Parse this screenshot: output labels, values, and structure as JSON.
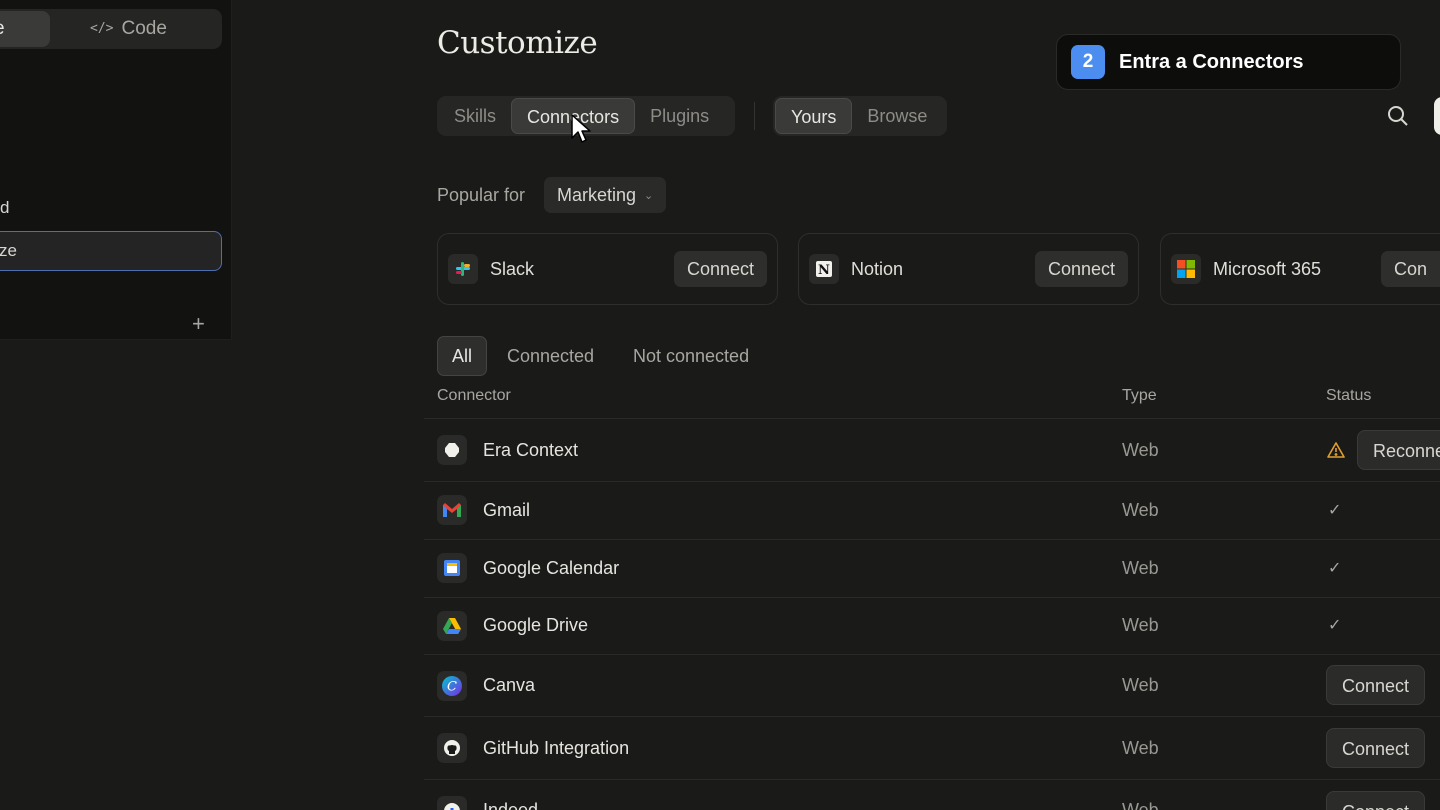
{
  "sidebar": {
    "mode_active_label": "e",
    "mode_code_label": "Code",
    "item_1": "d",
    "item_2": "ze",
    "plus_label": "+"
  },
  "page": {
    "title": "Customize"
  },
  "tabs": {
    "left": [
      "Skills",
      "Connectors",
      "Plugins"
    ],
    "right": [
      "Yours",
      "Browse"
    ],
    "active_left": "Connectors",
    "active_right": "Yours"
  },
  "popular": {
    "label": "Popular for",
    "selected": "Marketing"
  },
  "popular_cards": [
    {
      "name": "Slack",
      "button": "Connect",
      "icon": "slack-icon"
    },
    {
      "name": "Notion",
      "button": "Connect",
      "icon": "notion-icon"
    },
    {
      "name": "Microsoft 365",
      "button": "Con",
      "icon": "microsoft-365-icon"
    }
  ],
  "filters": {
    "all": "All",
    "connected": "Connected",
    "not_connected": "Not connected"
  },
  "table": {
    "headers": {
      "connector": "Connector",
      "type": "Type",
      "status": "Status"
    },
    "rows": [
      {
        "name": "Era Context",
        "type": "Web",
        "status": "warning",
        "action": "Reconne",
        "icon": "era-context-icon"
      },
      {
        "name": "Gmail",
        "type": "Web",
        "status": "connected",
        "check": "✓",
        "icon": "gmail-icon"
      },
      {
        "name": "Google Calendar",
        "type": "Web",
        "status": "connected",
        "check": "✓",
        "icon": "google-calendar-icon"
      },
      {
        "name": "Google Drive",
        "type": "Web",
        "status": "connected",
        "check": "✓",
        "icon": "google-drive-icon"
      },
      {
        "name": "Canva",
        "type": "Web",
        "status": "not_connected",
        "action": "Connect",
        "icon": "canva-icon"
      },
      {
        "name": "GitHub Integration",
        "type": "Web",
        "status": "not_connected",
        "action": "Connect",
        "icon": "github-icon"
      },
      {
        "name": "Indeed",
        "type": "Web",
        "status": "not_connected",
        "action": "Connect",
        "icon": "indeed-icon"
      }
    ]
  },
  "step_banner": {
    "number": "2",
    "text": "Entra a Connectors"
  },
  "colors": {
    "accent": "#4b8ef0",
    "warning": "#e0a030",
    "background": "#1a1a19"
  }
}
